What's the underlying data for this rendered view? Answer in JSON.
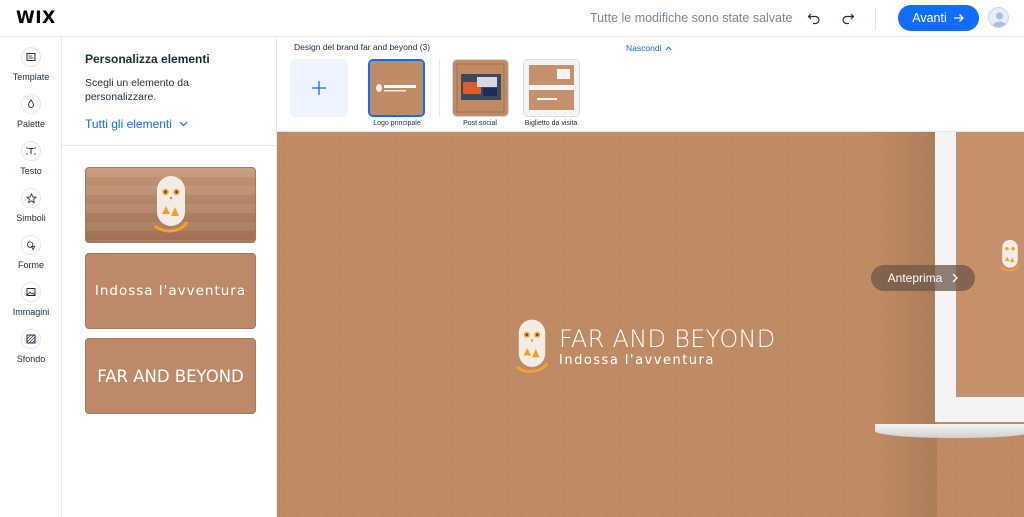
{
  "app": {
    "logo": "WIX"
  },
  "topbar": {
    "status": "Tutte le modifiche sono state salvate",
    "next_label": "Avanti"
  },
  "rail": {
    "items": [
      {
        "label": "Template",
        "icon": "template-icon"
      },
      {
        "label": "Palette",
        "icon": "palette-icon"
      },
      {
        "label": "Testo",
        "icon": "text-icon"
      },
      {
        "label": "Simboli",
        "icon": "star-icon"
      },
      {
        "label": "Forme",
        "icon": "shapes-icon"
      },
      {
        "label": "Immagini",
        "icon": "image-icon"
      },
      {
        "label": "Sfondo",
        "icon": "background-icon"
      }
    ]
  },
  "panel": {
    "title": "Personalizza elementi",
    "description": "Scegli un elemento da personalizzare.",
    "filter_label": "Tutti gli elementi",
    "cards": [
      {
        "text": ""
      },
      {
        "text": "Indossa l'avventura"
      },
      {
        "text": "FAR AND BEYOND"
      }
    ]
  },
  "strip": {
    "title": "Design del brand far and beyond (3)",
    "hide_label": "Nascondi",
    "items": [
      {
        "label": "Logo principale",
        "selected": true
      },
      {
        "label": "Post social",
        "selected": false
      },
      {
        "label": "Biglietto da visita",
        "selected": false
      }
    ]
  },
  "canvas": {
    "preview_label": "Anteprima",
    "brand_name": "FAR AND BEYOND",
    "tagline": "Indossa l'avventura",
    "bg_color": "#bf8b64"
  },
  "colors": {
    "accent": "#116dff",
    "brand_bg": "#bf8b64"
  }
}
